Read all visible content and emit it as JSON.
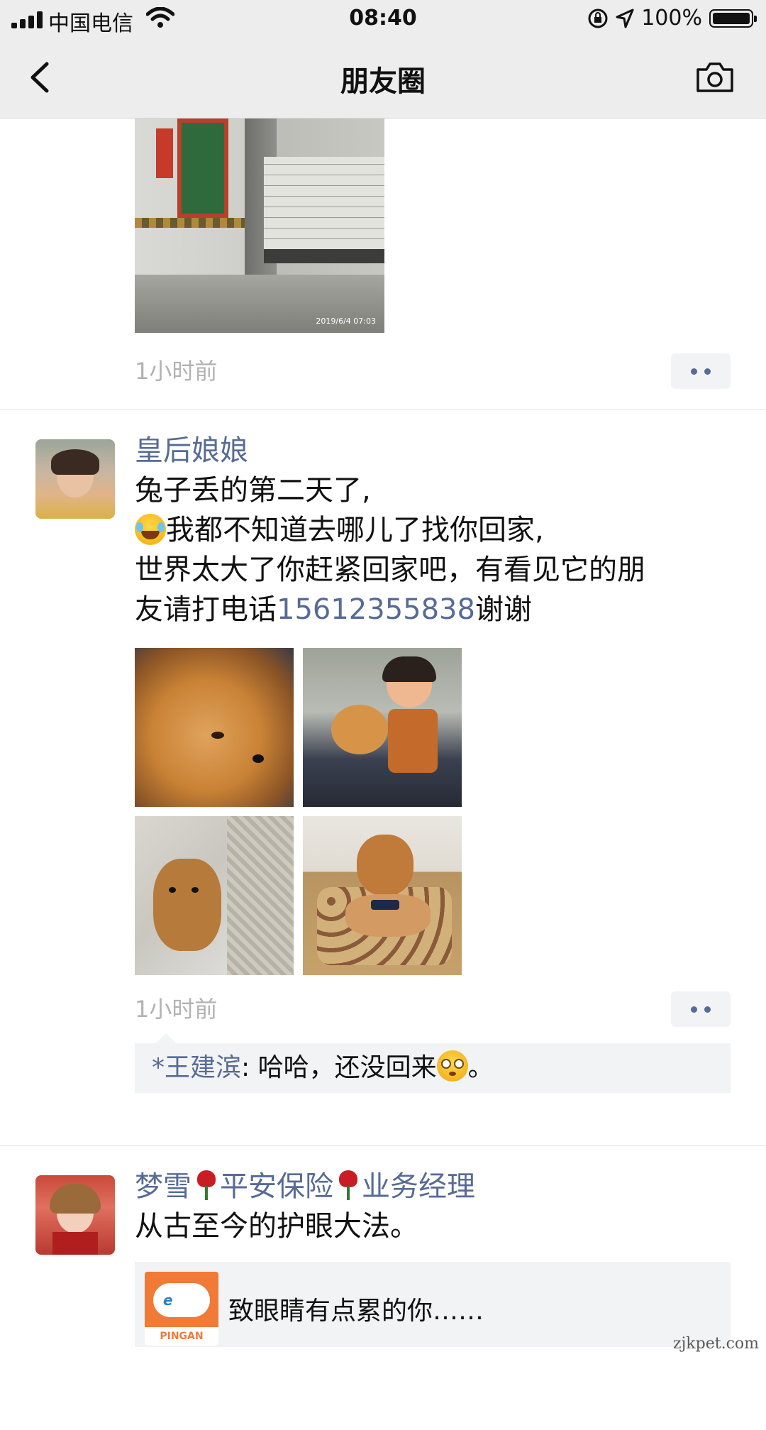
{
  "status_bar": {
    "carrier": "中国电信",
    "time": "08:40",
    "battery": "100%"
  },
  "nav": {
    "title": "朋友圈"
  },
  "posts": [
    {
      "time": "1小时前",
      "photo_stamp": "2019/6/4 07:03"
    },
    {
      "name": "皇后娘娘",
      "lines": [
        "兔子丢的第二天了,",
        "我都不知道去哪儿了找你回家,",
        "世界太大了你赶紧回家吧，有看见它的朋",
        "友请打电话"
      ],
      "phone": "15612355838",
      "line_tail": "谢谢",
      "time": "1小时前",
      "comment": {
        "name": "*王建滨",
        "sep": ": ",
        "text": "哈哈，还没回来",
        "tail": "。"
      }
    },
    {
      "name_parts": [
        "梦雪",
        "平安保险",
        "业务经理"
      ],
      "text": "从古至今的护眼大法。",
      "share": {
        "title": "致眼睛有点累的你……",
        "logo_caption": "PINGAN"
      }
    }
  ],
  "watermark": "zjkpet.com",
  "colors": {
    "link": "#576b95",
    "nav_bg": "#ededed",
    "time_gray": "#b2b2b2"
  }
}
